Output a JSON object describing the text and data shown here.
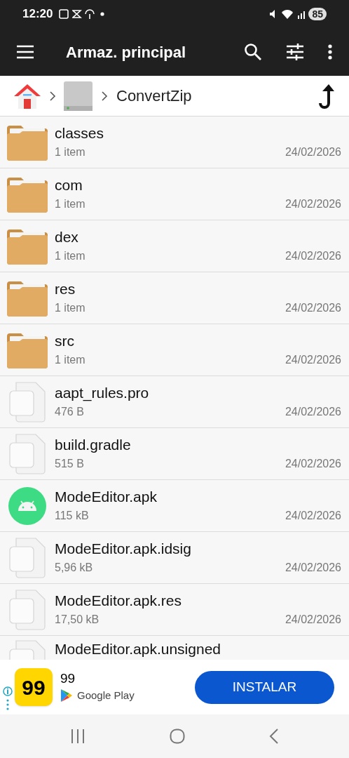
{
  "status_bar": {
    "time": "12:20",
    "battery": "85"
  },
  "app_bar": {
    "title": "Armaz. principal"
  },
  "breadcrumb": {
    "current": "ConvertZip"
  },
  "files": [
    {
      "kind": "folder",
      "name": "classes",
      "detail": "1 item",
      "date": "24/02/2026"
    },
    {
      "kind": "folder",
      "name": "com",
      "detail": "1 item",
      "date": "24/02/2026"
    },
    {
      "kind": "folder",
      "name": "dex",
      "detail": "1 item",
      "date": "24/02/2026"
    },
    {
      "kind": "folder",
      "name": "res",
      "detail": "1 item",
      "date": "24/02/2026"
    },
    {
      "kind": "folder",
      "name": "src",
      "detail": "1 item",
      "date": "24/02/2026"
    },
    {
      "kind": "file",
      "name": "aapt_rules.pro",
      "detail": "476 B",
      "date": "24/02/2026"
    },
    {
      "kind": "file",
      "name": "build.gradle",
      "detail": "515 B",
      "date": "24/02/2026"
    },
    {
      "kind": "apk",
      "name": "ModeEditor.apk",
      "detail": "115 kB",
      "date": "24/02/2026"
    },
    {
      "kind": "file",
      "name": "ModeEditor.apk.idsig",
      "detail": "5,96 kB",
      "date": "24/02/2026"
    },
    {
      "kind": "file",
      "name": "ModeEditor.apk.res",
      "detail": "17,50 kB",
      "date": "24/02/2026"
    },
    {
      "kind": "file",
      "name": "ModeEditor.apk.unsigned"
    }
  ],
  "ad": {
    "logo": "99",
    "app_name": "99",
    "store": "Google Play",
    "button": "INSTALAR"
  }
}
